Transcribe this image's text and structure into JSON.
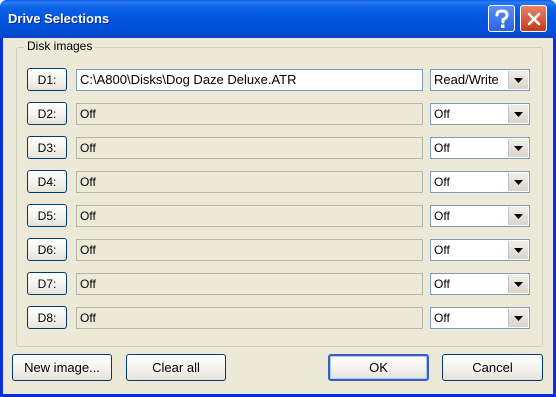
{
  "window": {
    "title": "Drive Selections"
  },
  "group": {
    "label": "Disk images"
  },
  "drives": [
    {
      "label": "D1:",
      "path": "C:\\A800\\Disks\\Dog Daze Deluxe.ATR",
      "mode": "Read/Write"
    },
    {
      "label": "D2:",
      "path": "Off",
      "mode": "Off"
    },
    {
      "label": "D3:",
      "path": "Off",
      "mode": "Off"
    },
    {
      "label": "D4:",
      "path": "Off",
      "mode": "Off"
    },
    {
      "label": "D5:",
      "path": "Off",
      "mode": "Off"
    },
    {
      "label": "D6:",
      "path": "Off",
      "mode": "Off"
    },
    {
      "label": "D7:",
      "path": "Off",
      "mode": "Off"
    },
    {
      "label": "D8:",
      "path": "Off",
      "mode": "Off"
    }
  ],
  "buttons": {
    "new_image": "New image...",
    "clear_all": "Clear all",
    "ok": "OK",
    "cancel": "Cancel"
  }
}
